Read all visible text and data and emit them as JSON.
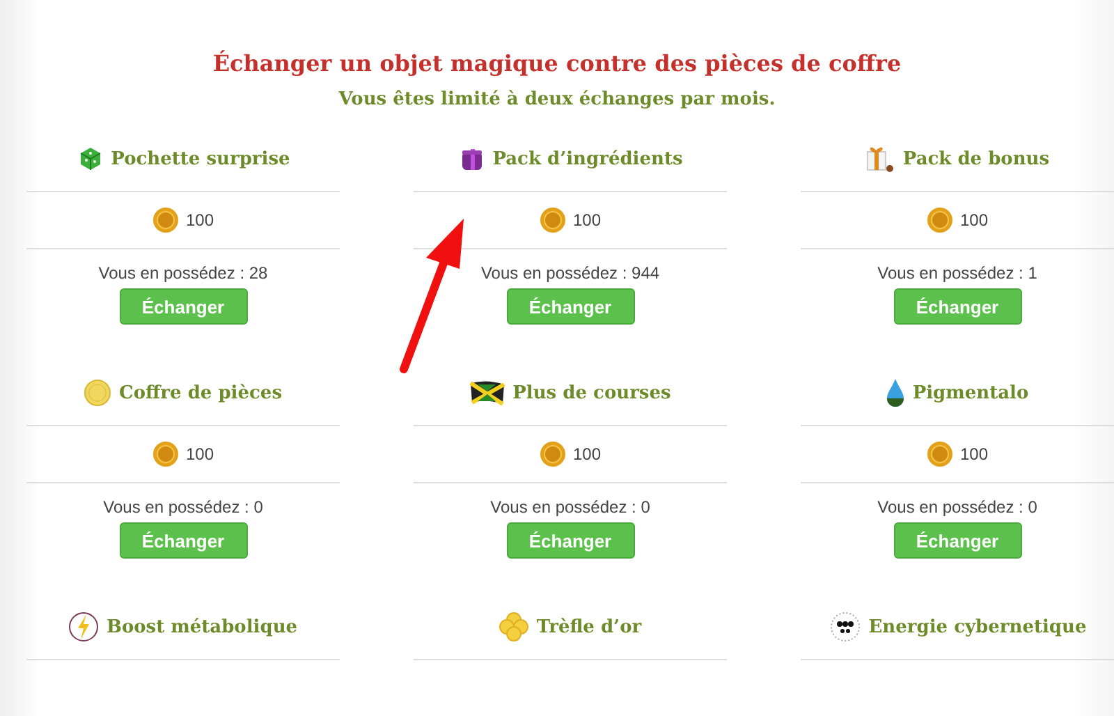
{
  "title": "Échanger un objet magique contre des pièces de coffre",
  "subtitle": "Vous êtes limité à deux échanges par mois.",
  "items": [
    {
      "name": "Pochette surprise",
      "price": "100",
      "owned": "Vous en possédez : 28",
      "button": "Échanger"
    },
    {
      "name": "Pack d’ingrédients",
      "price": "100",
      "owned": "Vous en possédez : 944",
      "button": "Échanger"
    },
    {
      "name": "Pack de bonus",
      "price": "100",
      "owned": "Vous en possédez : 1",
      "button": "Échanger"
    },
    {
      "name": "Coffre de pièces",
      "price": "100",
      "owned": "Vous en possédez : 0",
      "button": "Échanger"
    },
    {
      "name": "Plus de courses",
      "price": "100",
      "owned": "Vous en possédez : 0",
      "button": "Échanger"
    },
    {
      "name": "Pigmentalo",
      "price": "100",
      "owned": "Vous en possédez : 0",
      "button": "Échanger"
    },
    {
      "name": "Boost métabolique"
    },
    {
      "name": "Trèfle d’or"
    },
    {
      "name": "Energie cybernetique"
    }
  ]
}
